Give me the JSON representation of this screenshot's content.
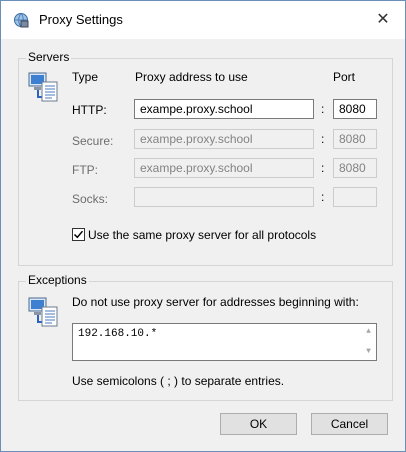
{
  "window": {
    "title": "Proxy Settings"
  },
  "servers": {
    "group_label": "Servers",
    "col_type": "Type",
    "col_address": "Proxy address to use",
    "col_port": "Port",
    "rows": [
      {
        "label": "HTTP:",
        "address": "exampe.proxy.school",
        "port": "8080",
        "enabled": true
      },
      {
        "label": "Secure:",
        "address": "exampe.proxy.school",
        "port": "8080",
        "enabled": false
      },
      {
        "label": "FTP:",
        "address": "exampe.proxy.school",
        "port": "8080",
        "enabled": false
      },
      {
        "label": "Socks:",
        "address": "",
        "port": "",
        "enabled": false
      }
    ],
    "separator": ":",
    "same_proxy_label": "Use the same proxy server for all protocols",
    "same_proxy_checked": true
  },
  "exceptions": {
    "group_label": "Exceptions",
    "description": "Do not use proxy server for addresses beginning with:",
    "value": "192.168.10.*",
    "hint": "Use semicolons ( ; ) to separate entries."
  },
  "buttons": {
    "ok": "OK",
    "cancel": "Cancel"
  },
  "icons": {
    "app": "proxy-settings-icon",
    "close": "close-icon",
    "group": "computer-document-icon"
  }
}
